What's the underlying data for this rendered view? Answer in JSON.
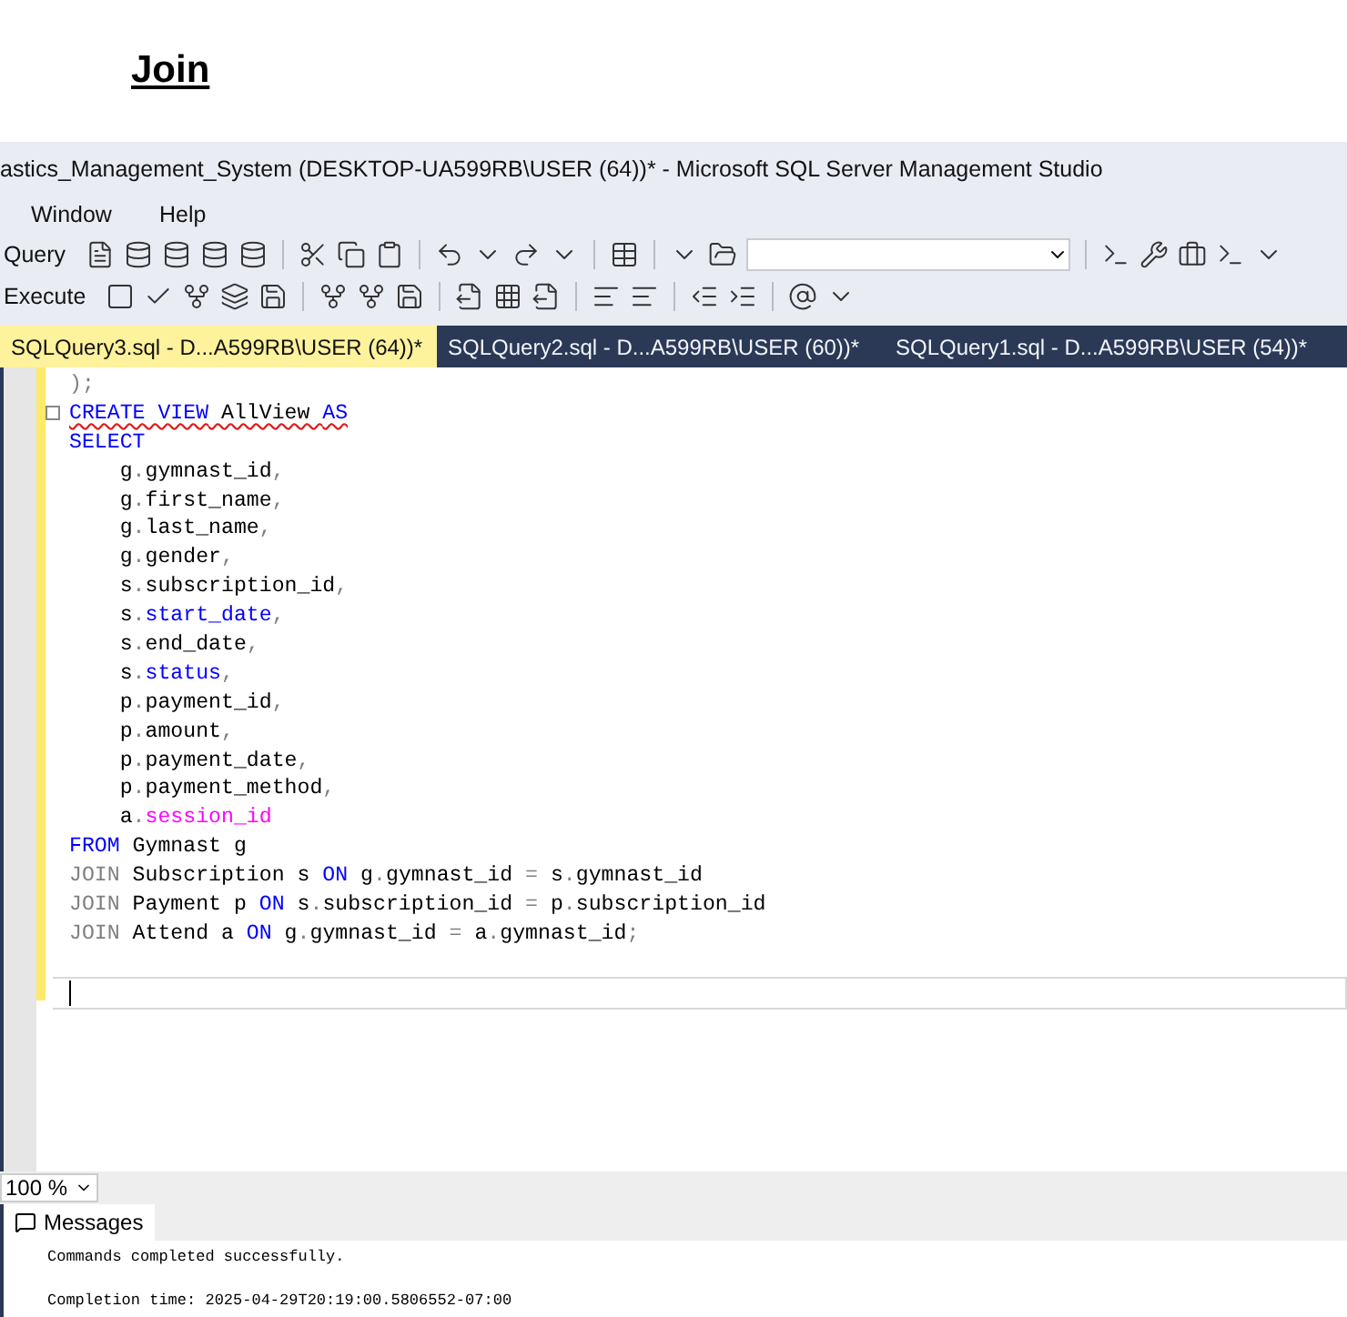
{
  "heading": "Join",
  "window": {
    "title": "astics_Management_System (DESKTOP-UA599RB\\USER (64))* - Microsoft SQL Server Management Studio"
  },
  "menu": [
    {
      "label": "Window"
    },
    {
      "label": "Help"
    }
  ],
  "toolbar_1": {
    "label": "Query"
  },
  "toolbar_2": {
    "label": "Execute"
  },
  "tabs": [
    {
      "label": "SQLQuery3.sql - D...A599RB\\USER (64))*",
      "selected": true
    },
    {
      "label": "SQLQuery2.sql - D...A599RB\\USER (60))*",
      "selected": false
    },
    {
      "label": "SQLQuery1.sql - D...A599RB\\USER (54))*",
      "selected": false
    }
  ],
  "editor": {
    "lines": [
      {
        "squiggle": false,
        "collapsible": false,
        "tokens": [
          {
            "kind": "gray",
            "text": ");"
          }
        ]
      },
      {
        "squiggle": true,
        "collapsible": true,
        "tokens": [
          {
            "kind": "kw",
            "text": "CREATE VIEW"
          },
          {
            "kind": "txt",
            "text": " AllView "
          },
          {
            "kind": "kw",
            "text": "AS"
          }
        ]
      },
      {
        "squiggle": false,
        "collapsible": false,
        "tokens": [
          {
            "kind": "kw",
            "text": "SELECT"
          }
        ]
      },
      {
        "squiggle": false,
        "collapsible": false,
        "tokens": [
          {
            "kind": "txt",
            "text": "    g"
          },
          {
            "kind": "gray",
            "text": "."
          },
          {
            "kind": "txt",
            "text": "gymnast_id"
          },
          {
            "kind": "gray",
            "text": ","
          }
        ]
      },
      {
        "squiggle": false,
        "collapsible": false,
        "tokens": [
          {
            "kind": "txt",
            "text": "    g"
          },
          {
            "kind": "gray",
            "text": "."
          },
          {
            "kind": "txt",
            "text": "first_name"
          },
          {
            "kind": "gray",
            "text": ","
          }
        ]
      },
      {
        "squiggle": false,
        "collapsible": false,
        "tokens": [
          {
            "kind": "txt",
            "text": "    g"
          },
          {
            "kind": "gray",
            "text": "."
          },
          {
            "kind": "txt",
            "text": "last_name"
          },
          {
            "kind": "gray",
            "text": ","
          }
        ]
      },
      {
        "squiggle": false,
        "collapsible": false,
        "tokens": [
          {
            "kind": "txt",
            "text": "    g"
          },
          {
            "kind": "gray",
            "text": "."
          },
          {
            "kind": "txt",
            "text": "gender"
          },
          {
            "kind": "gray",
            "text": ","
          }
        ]
      },
      {
        "squiggle": false,
        "collapsible": false,
        "tokens": [
          {
            "kind": "txt",
            "text": "    s"
          },
          {
            "kind": "gray",
            "text": "."
          },
          {
            "kind": "txt",
            "text": "subscription_id"
          },
          {
            "kind": "gray",
            "text": ","
          }
        ]
      },
      {
        "squiggle": false,
        "collapsible": false,
        "tokens": [
          {
            "kind": "txt",
            "text": "    s"
          },
          {
            "kind": "gray",
            "text": "."
          },
          {
            "kind": "kw",
            "text": "start_date"
          },
          {
            "kind": "gray",
            "text": ","
          }
        ]
      },
      {
        "squiggle": false,
        "collapsible": false,
        "tokens": [
          {
            "kind": "txt",
            "text": "    s"
          },
          {
            "kind": "gray",
            "text": "."
          },
          {
            "kind": "txt",
            "text": "end_date"
          },
          {
            "kind": "gray",
            "text": ","
          }
        ]
      },
      {
        "squiggle": false,
        "collapsible": false,
        "tokens": [
          {
            "kind": "txt",
            "text": "    s"
          },
          {
            "kind": "gray",
            "text": "."
          },
          {
            "kind": "kw",
            "text": "status"
          },
          {
            "kind": "gray",
            "text": ","
          }
        ]
      },
      {
        "squiggle": false,
        "collapsible": false,
        "tokens": [
          {
            "kind": "txt",
            "text": "    p"
          },
          {
            "kind": "gray",
            "text": "."
          },
          {
            "kind": "txt",
            "text": "payment_id"
          },
          {
            "kind": "gray",
            "text": ","
          }
        ]
      },
      {
        "squiggle": false,
        "collapsible": false,
        "tokens": [
          {
            "kind": "txt",
            "text": "    p"
          },
          {
            "kind": "gray",
            "text": "."
          },
          {
            "kind": "txt",
            "text": "amount"
          },
          {
            "kind": "gray",
            "text": ","
          }
        ]
      },
      {
        "squiggle": false,
        "collapsible": false,
        "tokens": [
          {
            "kind": "txt",
            "text": "    p"
          },
          {
            "kind": "gray",
            "text": "."
          },
          {
            "kind": "txt",
            "text": "payment_date"
          },
          {
            "kind": "gray",
            "text": ","
          }
        ]
      },
      {
        "squiggle": false,
        "collapsible": false,
        "tokens": [
          {
            "kind": "txt",
            "text": "    p"
          },
          {
            "kind": "gray",
            "text": "."
          },
          {
            "kind": "txt",
            "text": "payment_method"
          },
          {
            "kind": "gray",
            "text": ","
          }
        ]
      },
      {
        "squiggle": false,
        "collapsible": false,
        "tokens": [
          {
            "kind": "txt",
            "text": "    a"
          },
          {
            "kind": "gray",
            "text": "."
          },
          {
            "kind": "mag",
            "text": "session_id"
          }
        ]
      },
      {
        "squiggle": false,
        "collapsible": false,
        "tokens": [
          {
            "kind": "kw",
            "text": "FROM"
          },
          {
            "kind": "txt",
            "text": " Gymnast g"
          }
        ]
      },
      {
        "squiggle": false,
        "collapsible": false,
        "tokens": [
          {
            "kind": "gray",
            "text": "JOIN"
          },
          {
            "kind": "txt",
            "text": " Subscription s "
          },
          {
            "kind": "kw",
            "text": "ON"
          },
          {
            "kind": "txt",
            "text": " g"
          },
          {
            "kind": "gray",
            "text": "."
          },
          {
            "kind": "txt",
            "text": "gymnast_id "
          },
          {
            "kind": "gray",
            "text": "="
          },
          {
            "kind": "txt",
            "text": " s"
          },
          {
            "kind": "gray",
            "text": "."
          },
          {
            "kind": "txt",
            "text": "gymnast_id"
          }
        ]
      },
      {
        "squiggle": false,
        "collapsible": false,
        "tokens": [
          {
            "kind": "gray",
            "text": "JOIN"
          },
          {
            "kind": "txt",
            "text": " Payment p "
          },
          {
            "kind": "kw",
            "text": "ON"
          },
          {
            "kind": "txt",
            "text": " s"
          },
          {
            "kind": "gray",
            "text": "."
          },
          {
            "kind": "txt",
            "text": "subscription_id "
          },
          {
            "kind": "gray",
            "text": "="
          },
          {
            "kind": "txt",
            "text": " p"
          },
          {
            "kind": "gray",
            "text": "."
          },
          {
            "kind": "txt",
            "text": "subscription_id"
          }
        ]
      },
      {
        "squiggle": false,
        "collapsible": false,
        "tokens": [
          {
            "kind": "gray",
            "text": "JOIN"
          },
          {
            "kind": "txt",
            "text": " Attend a "
          },
          {
            "kind": "kw",
            "text": "ON"
          },
          {
            "kind": "txt",
            "text": " g"
          },
          {
            "kind": "gray",
            "text": "."
          },
          {
            "kind": "txt",
            "text": "gymnast_id "
          },
          {
            "kind": "gray",
            "text": "="
          },
          {
            "kind": "txt",
            "text": " a"
          },
          {
            "kind": "gray",
            "text": "."
          },
          {
            "kind": "txt",
            "text": "gymnast_id"
          },
          {
            "kind": "gray",
            "text": ";"
          }
        ]
      }
    ]
  },
  "zoom": "100 %",
  "results": {
    "tab": "Messages",
    "lines": [
      "Commands completed successfully.",
      "Completion time: 2025-04-29T20:19:00.5806552-07:00"
    ]
  }
}
